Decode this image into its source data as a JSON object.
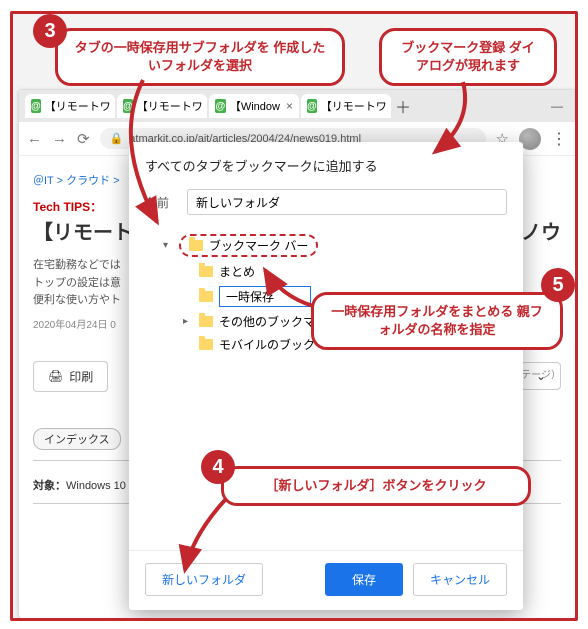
{
  "browser": {
    "tabs": [
      {
        "favicon": "@",
        "label": "【リモートワ",
        "close": "×"
      },
      {
        "favicon": "@",
        "label": "【リモートワ",
        "close": "×"
      },
      {
        "favicon": "@",
        "label": "【Window",
        "close": "×"
      },
      {
        "favicon": "@",
        "label": "【リモートワ",
        "close": "×"
      }
    ],
    "newtab": "＋",
    "winmin": "—",
    "nav_back": "←",
    "nav_fwd": "→",
    "nav_reload": "⟳",
    "lock": "🔒",
    "url": "atmarkit.co.jp/ait/articles/2004/24/news019.html",
    "star": "☆",
    "kebab": "⋮"
  },
  "page": {
    "crumbs": "＠IT > クラウド >",
    "tips": "Tech TIPS：",
    "h1a": "【リモート",
    "h1b": "遠隔操作活用ノウ",
    "lead": "在宅勤務などでは\nトップの設定は意\n便利な使い方やト",
    "date": "2020年04月24日 0",
    "adv": "アドバンテージ）",
    "print_icon": "🖨",
    "print": "印刷",
    "pocket_icon": "⌄",
    "index": "インデックス",
    "target_label": "対象：",
    "target_val": "Windows 10"
  },
  "dialog": {
    "title": "すべてのタブをブックマークに追加する",
    "name_label": "名前",
    "name_value": "新しいフォルダ",
    "tree": {
      "root": "ブックマーク バー",
      "child1": "まとめ",
      "editing": "一時保存",
      "other": "その他のブックマーク",
      "mobile": "モバイルのブックマーク"
    },
    "btn_newfolder": "新しいフォルダ",
    "btn_save": "保存",
    "btn_cancel": "キャンセル"
  },
  "callouts": {
    "c3": "タブの一時保存用サブフォルダを\n作成したいフォルダを選択",
    "cTop": "ブックマーク登録\nダイアログが現れます",
    "c5": "一時保存用フォルダをまとめる\n親フォルダの名称を指定",
    "c4": "［新しいフォルダ］ボタンをクリック"
  },
  "nums": {
    "n3": "3",
    "n4": "4",
    "n5": "5"
  }
}
